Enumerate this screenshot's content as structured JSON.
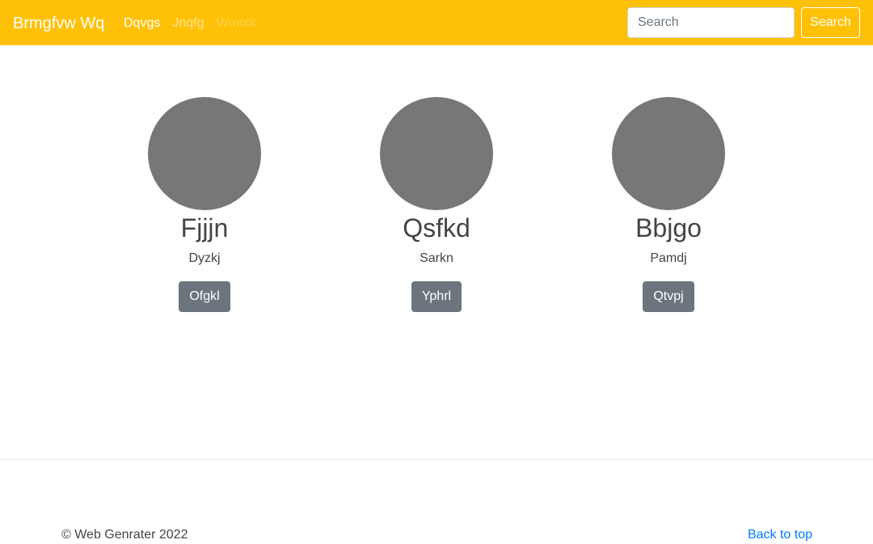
{
  "navbar": {
    "brand": "Brmgfvw Wq",
    "links": [
      {
        "label": "Dqvgs",
        "state": "active"
      },
      {
        "label": "Jnqfg",
        "state": "normal"
      },
      {
        "label": "Wmotk",
        "state": "disabled"
      }
    ],
    "search": {
      "placeholder": "Search",
      "value": "",
      "button_label": "Search"
    },
    "bg_color": "#ffc107"
  },
  "cards": [
    {
      "name": "Fjjjn",
      "role": "Dyzkj",
      "button": "Ofgkl"
    },
    {
      "name": "Qsfkd",
      "role": "Sarkn",
      "button": "Yphrl"
    },
    {
      "name": "Bbjgo",
      "role": "Pamdj",
      "button": "Qtvpj"
    }
  ],
  "footer": {
    "copyright": "© Web Genrater 2022",
    "back_to_top": "Back to top"
  }
}
